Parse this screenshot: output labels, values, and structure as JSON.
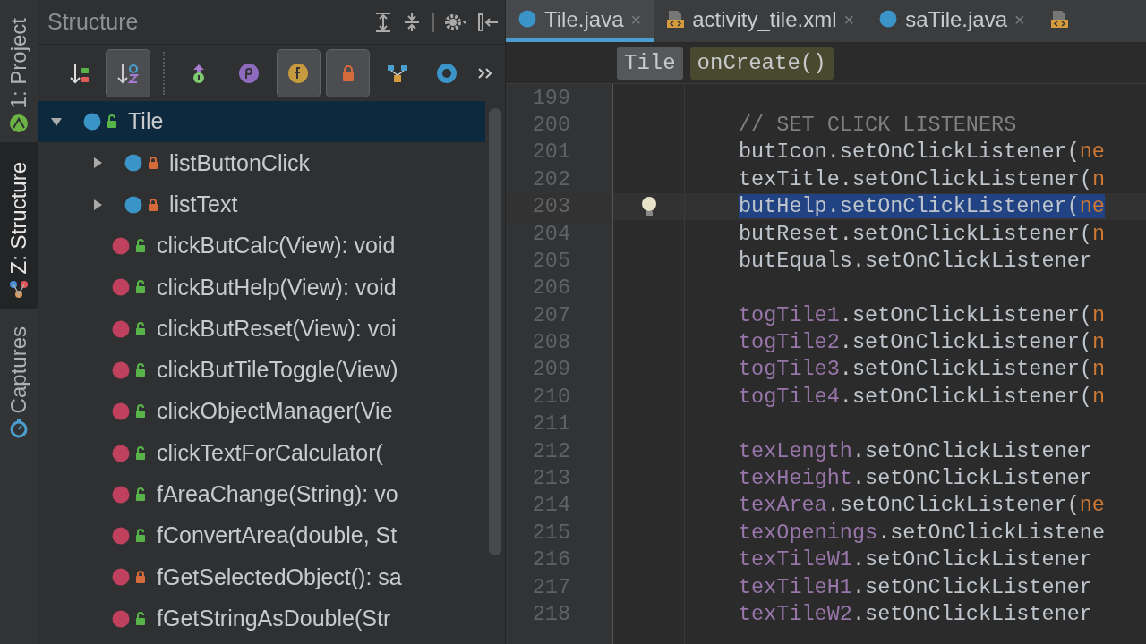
{
  "side_tabs": [
    {
      "label": "1: Project",
      "selected": false
    },
    {
      "label": "Z: Structure",
      "selected": true
    },
    {
      "label": "Captures",
      "selected": false
    }
  ],
  "structure_panel": {
    "title": "Structure",
    "toolbar": [
      {
        "selected": false
      },
      {
        "selected": true
      },
      {
        "selected": false
      },
      {
        "selected": false
      },
      {
        "selected": true
      },
      {
        "selected": true
      },
      {
        "selected": false
      },
      {
        "selected": false
      },
      {
        "selected": false
      }
    ],
    "tree": [
      {
        "label": "Tile",
        "kind": "class",
        "locked": false,
        "expanded": true,
        "selected": true,
        "children": [
          {
            "label": "listButtonClick",
            "kind": "class",
            "locked": true,
            "expanded": false,
            "selected": false
          },
          {
            "label": "listText",
            "kind": "class",
            "locked": true,
            "expanded": false,
            "selected": false
          },
          {
            "label": "clickButCalc(View): void",
            "kind": "method",
            "locked": false,
            "selected": false
          },
          {
            "label": "clickButHelp(View): void",
            "kind": "method",
            "locked": false,
            "selected": false
          },
          {
            "label": "clickButReset(View): voi",
            "kind": "method",
            "locked": false,
            "selected": false
          },
          {
            "label": "clickButTileToggle(View)",
            "kind": "method",
            "locked": false,
            "selected": false
          },
          {
            "label": "clickObjectManager(Vie",
            "kind": "method",
            "locked": false,
            "selected": false
          },
          {
            "label": "clickTextForCalculator(",
            "kind": "method",
            "locked": false,
            "selected": false
          },
          {
            "label": "fAreaChange(String): vo",
            "kind": "method",
            "locked": false,
            "selected": false
          },
          {
            "label": "fConvertArea(double, St",
            "kind": "method",
            "locked": false,
            "selected": false
          },
          {
            "label": "fGetSelectedObject(): sa",
            "kind": "method",
            "locked": true,
            "selected": false
          },
          {
            "label": "fGetStringAsDouble(Str",
            "kind": "method",
            "locked": false,
            "selected": false
          }
        ]
      }
    ]
  },
  "editor": {
    "tabs": [
      {
        "label": "Tile.java",
        "kind": "class",
        "selected": true,
        "close": "×"
      },
      {
        "label": "activity_tile.xml",
        "kind": "xml",
        "selected": false,
        "close": "×"
      },
      {
        "label": "saTile.java",
        "kind": "class",
        "selected": false,
        "close": "×"
      },
      {
        "kind": "xml",
        "selected": false
      }
    ],
    "breadcrumbs": [
      {
        "label": "Tile",
        "kind": "class"
      },
      {
        "label": "onCreate()",
        "kind": "method"
      }
    ],
    "lines": [
      {
        "number": "199"
      },
      {
        "number": "200",
        "segments": [
          {
            "text": "// SET CLICK LISTENERS",
            "kind": "comment"
          }
        ]
      },
      {
        "number": "201",
        "segments": [
          {
            "text": "butIcon.setOnClickListener(",
            "kind": "plain"
          },
          {
            "text": "ne",
            "kind": "keyword"
          }
        ]
      },
      {
        "number": "202",
        "segments": [
          {
            "text": "texTitle.setOnClickListener(",
            "kind": "plain"
          },
          {
            "text": "n",
            "kind": "keyword"
          }
        ]
      },
      {
        "number": "203",
        "current": true,
        "segments": [
          {
            "text": "butHelp.setOnClickListener(",
            "kind": "plain",
            "selected": true
          },
          {
            "text": "ne",
            "kind": "keyword",
            "selected": true
          }
        ]
      },
      {
        "number": "204",
        "segments": [
          {
            "text": "butReset.setOnClickListener(",
            "kind": "plain"
          },
          {
            "text": "n",
            "kind": "keyword"
          }
        ]
      },
      {
        "number": "205",
        "segments": [
          {
            "text": "butEquals.setOnClickListener",
            "kind": "plain"
          }
        ]
      },
      {
        "number": "206"
      },
      {
        "number": "207",
        "segments": [
          {
            "text": "togTile1",
            "kind": "field"
          },
          {
            "text": ".setOnClickListener(",
            "kind": "plain"
          },
          {
            "text": "n",
            "kind": "keyword"
          }
        ]
      },
      {
        "number": "208",
        "segments": [
          {
            "text": "togTile2",
            "kind": "field"
          },
          {
            "text": ".setOnClickListener(",
            "kind": "plain"
          },
          {
            "text": "n",
            "kind": "keyword"
          }
        ]
      },
      {
        "number": "209",
        "segments": [
          {
            "text": "togTile3",
            "kind": "field"
          },
          {
            "text": ".setOnClickListener(",
            "kind": "plain"
          },
          {
            "text": "n",
            "kind": "keyword"
          }
        ]
      },
      {
        "number": "210",
        "segments": [
          {
            "text": "togTile4",
            "kind": "field"
          },
          {
            "text": ".setOnClickListener(",
            "kind": "plain"
          },
          {
            "text": "n",
            "kind": "keyword"
          }
        ]
      },
      {
        "number": "211"
      },
      {
        "number": "212",
        "segments": [
          {
            "text": "texLength",
            "kind": "field"
          },
          {
            "text": ".setOnClickListener",
            "kind": "plain"
          }
        ]
      },
      {
        "number": "213",
        "segments": [
          {
            "text": "texHeight",
            "kind": "field"
          },
          {
            "text": ".setOnClickListener",
            "kind": "plain"
          }
        ]
      },
      {
        "number": "214",
        "segments": [
          {
            "text": "texArea",
            "kind": "field"
          },
          {
            "text": ".setOnClickListener(",
            "kind": "plain"
          },
          {
            "text": "ne",
            "kind": "keyword"
          }
        ]
      },
      {
        "number": "215",
        "segments": [
          {
            "text": "texOpenings",
            "kind": "field"
          },
          {
            "text": ".setOnClickListene",
            "kind": "plain"
          }
        ]
      },
      {
        "number": "216",
        "segments": [
          {
            "text": "texTileW1",
            "kind": "field"
          },
          {
            "text": ".setOnClickListener",
            "kind": "plain"
          }
        ]
      },
      {
        "number": "217",
        "segments": [
          {
            "text": "texTileH1",
            "kind": "field"
          },
          {
            "text": ".setOnClickListener",
            "kind": "plain"
          }
        ]
      },
      {
        "number": "218",
        "segments": [
          {
            "text": "texTileW2",
            "kind": "field"
          },
          {
            "text": ".setOnClickListener",
            "kind": "plain"
          }
        ]
      }
    ]
  }
}
